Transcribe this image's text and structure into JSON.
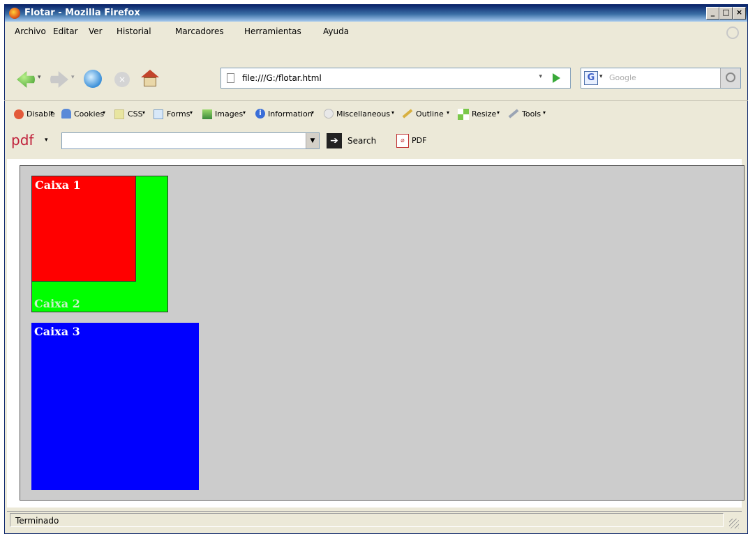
{
  "window": {
    "title": "Flotar - Mozilla Firefox",
    "min": "_",
    "max": "□",
    "close": "×"
  },
  "menu": [
    "Archivo",
    "Editar",
    "Ver",
    "Historial",
    "Marcadores",
    "Herramientas",
    "Ayuda"
  ],
  "nav": {
    "url": "file:///G:/flotar.html",
    "search_engine": "G",
    "search_placeholder": "Google"
  },
  "webdev_toolbar": [
    "Disable",
    "Cookies",
    "CSS",
    "Forms",
    "Images",
    "Information",
    "Miscellaneous",
    "Outline",
    "Resize",
    "Tools"
  ],
  "pdf_toolbar": {
    "logo": "pdf",
    "search_label": "Search",
    "pdf_label": "PDF"
  },
  "page": {
    "caixa1": {
      "label": "Caixa 1",
      "color": "#ff0000"
    },
    "caixa2": {
      "label": "Caixa 2",
      "color": "#00ff00"
    },
    "caixa3": {
      "label": "Caixa 3",
      "color": "#0000ff"
    },
    "background": "#cccccc"
  },
  "status": {
    "text": "Terminado"
  }
}
